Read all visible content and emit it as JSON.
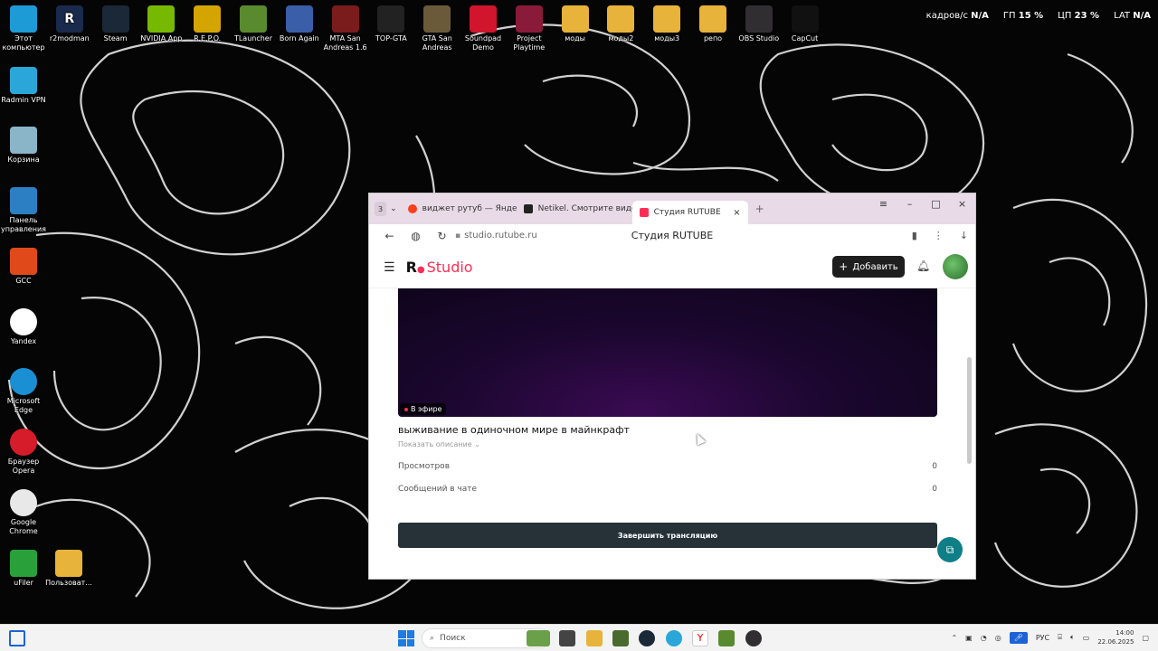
{
  "desktop": {
    "icons": [
      {
        "label": "Этот компьютер",
        "color": "#1c9bd7"
      },
      {
        "label": "r2modman",
        "color": "#1a2a4d",
        "glyph": "R"
      },
      {
        "label": "Steam",
        "color": "#1b2838"
      },
      {
        "label": "NVIDIA App",
        "color": "#76b900"
      },
      {
        "label": "R.E.P.O.",
        "color": "#d4a400"
      },
      {
        "label": "TLauncher",
        "color": "#5a8a2e"
      },
      {
        "label": "Born Again",
        "color": "#3a5ea8"
      },
      {
        "label": "MTA San Andreas 1.6",
        "color": "#7a1c1c"
      },
      {
        "label": "TOP-GTA",
        "color": "#222222"
      },
      {
        "label": "GTA San Andreas",
        "color": "#6b5a3a"
      },
      {
        "label": "Soundpad Demo",
        "color": "#d1152c"
      },
      {
        "label": "Project Playtime",
        "color": "#8a1a3a"
      },
      {
        "label": "моды",
        "color": "#e8b33a"
      },
      {
        "label": "моды2",
        "color": "#e8b33a"
      },
      {
        "label": "моды3",
        "color": "#e8b33a"
      },
      {
        "label": "репо",
        "color": "#e8b33a"
      },
      {
        "label": "OBS Studio",
        "color": "#302e31"
      },
      {
        "label": "CapCut",
        "color": "#111111"
      }
    ],
    "left_icons": [
      {
        "label": "Radmin VPN",
        "color": "#2aa7d8"
      },
      {
        "label": "Корзина",
        "color": "#8ab4c8"
      },
      {
        "label": "Панель управления",
        "color": "#2d7fc4"
      },
      {
        "label": "GCC",
        "color": "#e04a1a"
      },
      {
        "label": "Yandex",
        "color": "#ffffff"
      },
      {
        "label": "Microsoft Edge",
        "color": "#1a8fd4"
      },
      {
        "label": "Браузер Opera",
        "color": "#d61c2a"
      },
      {
        "label": "Google Chrome",
        "color": "#e8e8e8"
      },
      {
        "label": "uFiler",
        "color": "#2aa03a"
      },
      {
        "label": "Пользоват...",
        "color": "#e8b33a"
      }
    ]
  },
  "osd": {
    "fps_label": "кадров/с",
    "fps_value": "N/A",
    "gpu_label": "ГП",
    "gpu_value": "15 %",
    "cpu_label": "ЦП",
    "cpu_value": "23 %",
    "lat_label": "LAT",
    "lat_value": "N/A"
  },
  "browser": {
    "tab_count": "3",
    "tabs": [
      {
        "title": "виджет рутуб — Яндекс: н",
        "favicon_color": "#fc3f1d"
      },
      {
        "title": "Netikel. Смотрите видео",
        "favicon_color": "#222222"
      },
      {
        "title": "Студия RUTUBE",
        "favicon_color": "#ff2d55"
      }
    ],
    "url": "studio.rutube.ru",
    "page_title": "Студия RUTUBE"
  },
  "studio": {
    "logo_r": "R",
    "logo_text": "Studio",
    "add_label": "Добавить",
    "live_badge": "В эфире",
    "stream_title": "выживание в одиночном мире в майнкрафт",
    "show_description": "Показать описание",
    "stats": [
      {
        "label": "Просмотров",
        "value": "0"
      },
      {
        "label": "Сообщений в чате",
        "value": "0"
      }
    ],
    "stop_button": "Завершить трансляцию"
  },
  "taskbar": {
    "search_placeholder": "Поиск",
    "lang": "РУС",
    "time": "14:00",
    "date": "22.06.2025"
  }
}
